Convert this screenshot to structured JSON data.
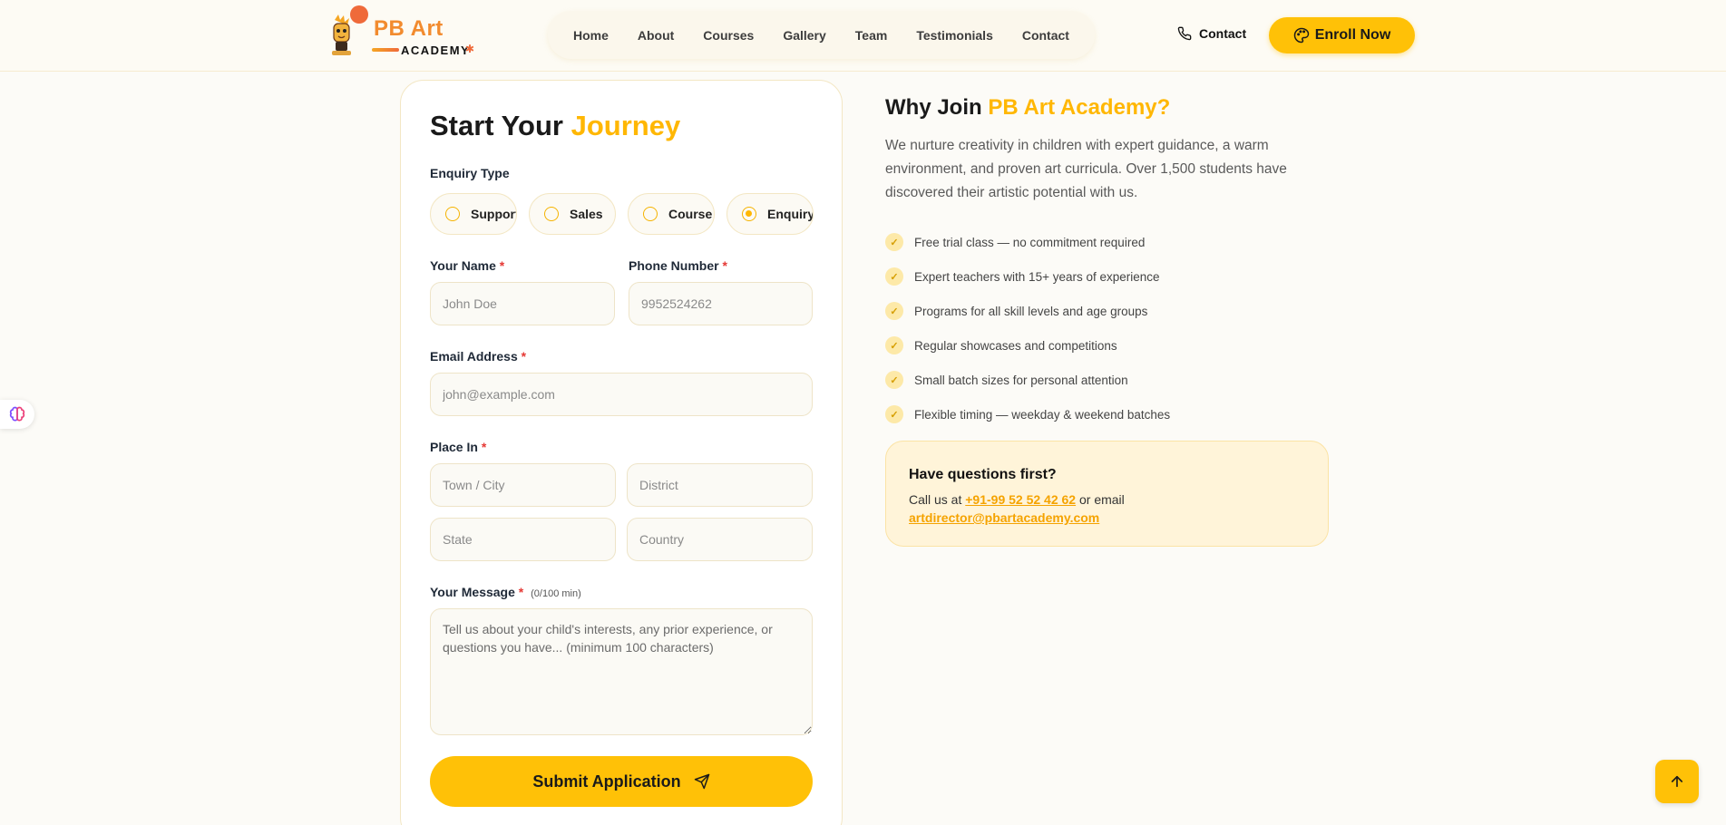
{
  "brand": {
    "title": "PB Art",
    "subtitle": "ACADEMY",
    "colors": {
      "accent": "#ffc107",
      "accent_text": "#ffb703",
      "logo_orange": "#f28b2e"
    }
  },
  "nav": {
    "items": [
      {
        "label": "Home"
      },
      {
        "label": "About"
      },
      {
        "label": "Courses"
      },
      {
        "label": "Gallery"
      },
      {
        "label": "Team"
      },
      {
        "label": "Testimonials"
      },
      {
        "label": "Contact"
      }
    ],
    "contact_label": "Contact",
    "contact_icon": "phone-icon",
    "enroll_label": "Enroll Now",
    "enroll_icon": "palette-icon"
  },
  "form": {
    "title_main": "Start Your",
    "title_accent": "Journey",
    "enquiry_type_label": "Enquiry Type",
    "enquiry_options": [
      {
        "label": "Support",
        "selected": false
      },
      {
        "label": "Sales",
        "selected": false
      },
      {
        "label": "Course",
        "selected": false
      },
      {
        "label": "Enquiry",
        "selected": true
      }
    ],
    "name": {
      "label": "Your Name",
      "placeholder": "John Doe",
      "value": ""
    },
    "phone": {
      "label": "Phone Number",
      "placeholder": "9952524262",
      "value": ""
    },
    "email": {
      "label": "Email Address",
      "placeholder": "john@example.com",
      "value": ""
    },
    "place": {
      "label": "Place In",
      "town_placeholder": "Town / City",
      "district_placeholder": "District",
      "state_placeholder": "State",
      "country_placeholder": "Country"
    },
    "message": {
      "label": "Your Message",
      "hint": "(0/100 min)",
      "placeholder": "Tell us about your child's interests, any prior experience, or questions you have... (minimum 100 characters)"
    },
    "required_mark": "*",
    "submit_label": "Submit Application",
    "submit_icon": "send-icon"
  },
  "why": {
    "title_main": "Why Join",
    "title_accent": "PB Art Academy?",
    "description": "We nurture creativity in children with expert guidance, a warm environment, and proven art curricula. Over 1,500 students have discovered their artistic potential with us.",
    "benefits": [
      "Free trial class — no commitment required",
      "Expert teachers with 15+ years of experience",
      "Programs for all skill levels and age groups",
      "Regular showcases and competitions",
      "Small batch sizes for personal attention",
      "Flexible timing — weekday & weekend batches"
    ],
    "questions": {
      "title": "Have questions first?",
      "call_prefix": "Call us at",
      "phone": "+91-99 52 52 42 62",
      "email_prefix": "or email",
      "email": "artdirector@pbartacademy.com"
    }
  },
  "widgets": {
    "side_icon": "brain-icon",
    "scroll_top_icon": "arrow-up-icon"
  }
}
